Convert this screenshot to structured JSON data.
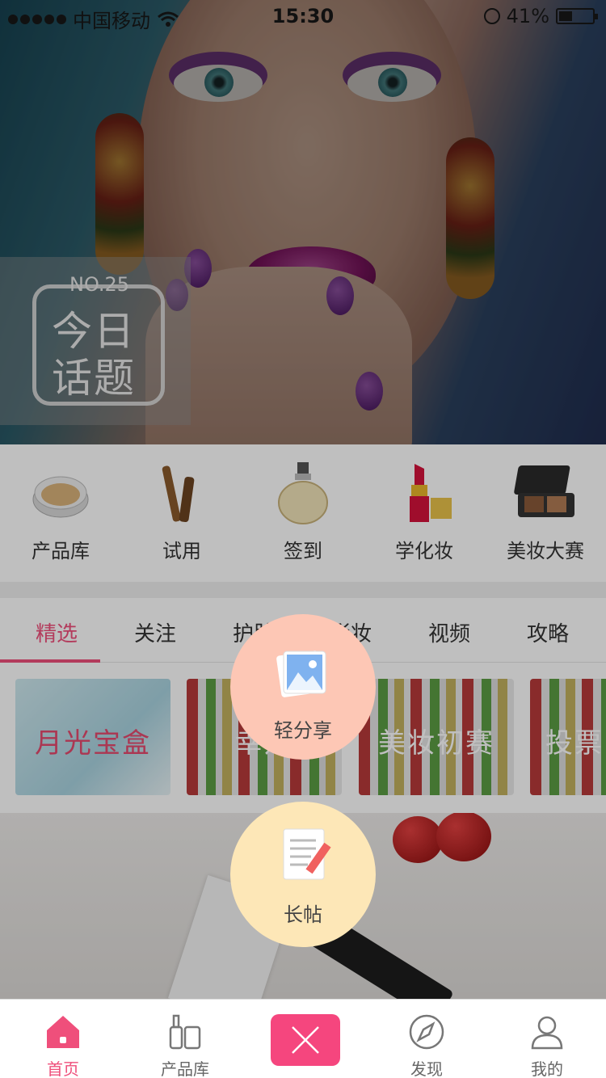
{
  "status_bar": {
    "carrier": "中国移动",
    "time": "15:30",
    "battery": "41%",
    "battery_level": 0.41
  },
  "banner": {
    "topic_no": "NO.25",
    "topic_line1": "今日",
    "topic_line2": "话题"
  },
  "categories": [
    {
      "label": "产品库",
      "icon": "cushion-compact-icon"
    },
    {
      "label": "试用",
      "icon": "mascara-icon"
    },
    {
      "label": "签到",
      "icon": "perfume-bottle-icon"
    },
    {
      "label": "学化妆",
      "icon": "lipstick-icon"
    },
    {
      "label": "美妆大赛",
      "icon": "eyeshadow-palette-icon"
    }
  ],
  "tabs": [
    {
      "label": "精选",
      "active": true
    },
    {
      "label": "关注"
    },
    {
      "label": "护肤"
    },
    {
      "label": "彩妆"
    },
    {
      "label": "视频"
    },
    {
      "label": "攻略"
    }
  ],
  "cards": [
    {
      "title": "月光宝盒"
    },
    {
      "title": "幸运"
    },
    {
      "title": "美妆初赛"
    },
    {
      "title": "投票"
    }
  ],
  "popup": {
    "share_label": "轻分享",
    "share_icon": "picture-icon",
    "long_label": "长帖",
    "long_icon": "notepad-pencil-icon"
  },
  "tab_bar": [
    {
      "label": "首页",
      "icon": "home-icon",
      "active": true
    },
    {
      "label": "产品库",
      "icon": "cosmetics-icon"
    },
    {
      "label": "",
      "icon": "close-icon"
    },
    {
      "label": "发现",
      "icon": "compass-icon"
    },
    {
      "label": "我的",
      "icon": "user-icon"
    }
  ],
  "colors": {
    "accent": "#ef4f7b",
    "close_button": "#f5467e",
    "share_bubble": "#fdc7b5",
    "long_bubble": "#fde7b7"
  }
}
